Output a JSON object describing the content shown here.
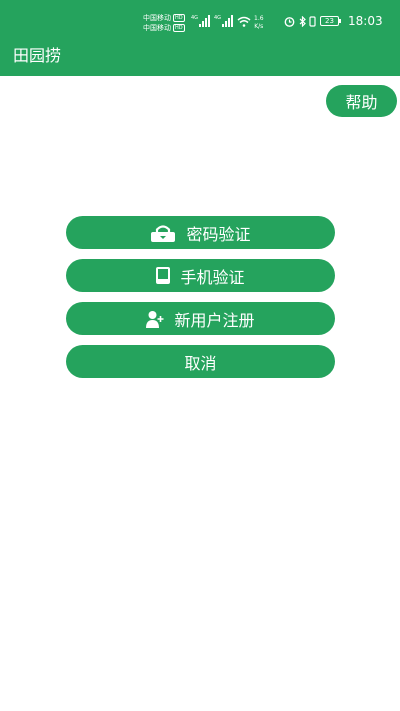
{
  "status_bar": {
    "carrier_1": "中国移动",
    "carrier_2": "中国移动",
    "hd_badge": "HD",
    "network_type": "4G",
    "net_speed_value": "1.6",
    "net_speed_unit": "K/s",
    "battery_level": "23",
    "time": "18:03"
  },
  "app_bar": {
    "title": "田园捞"
  },
  "help_button": {
    "label": "帮助"
  },
  "actions": {
    "password_verify": {
      "label": "密码验证",
      "icon": "lock-icon"
    },
    "phone_verify": {
      "label": "手机验证",
      "icon": "tablet-icon"
    },
    "new_user_register": {
      "label": "新用户注册",
      "icon": "add-user-icon"
    },
    "cancel": {
      "label": "取消"
    }
  },
  "colors": {
    "accent": "#25a35d",
    "text_on_accent": "#ffffff",
    "background": "#ffffff"
  }
}
